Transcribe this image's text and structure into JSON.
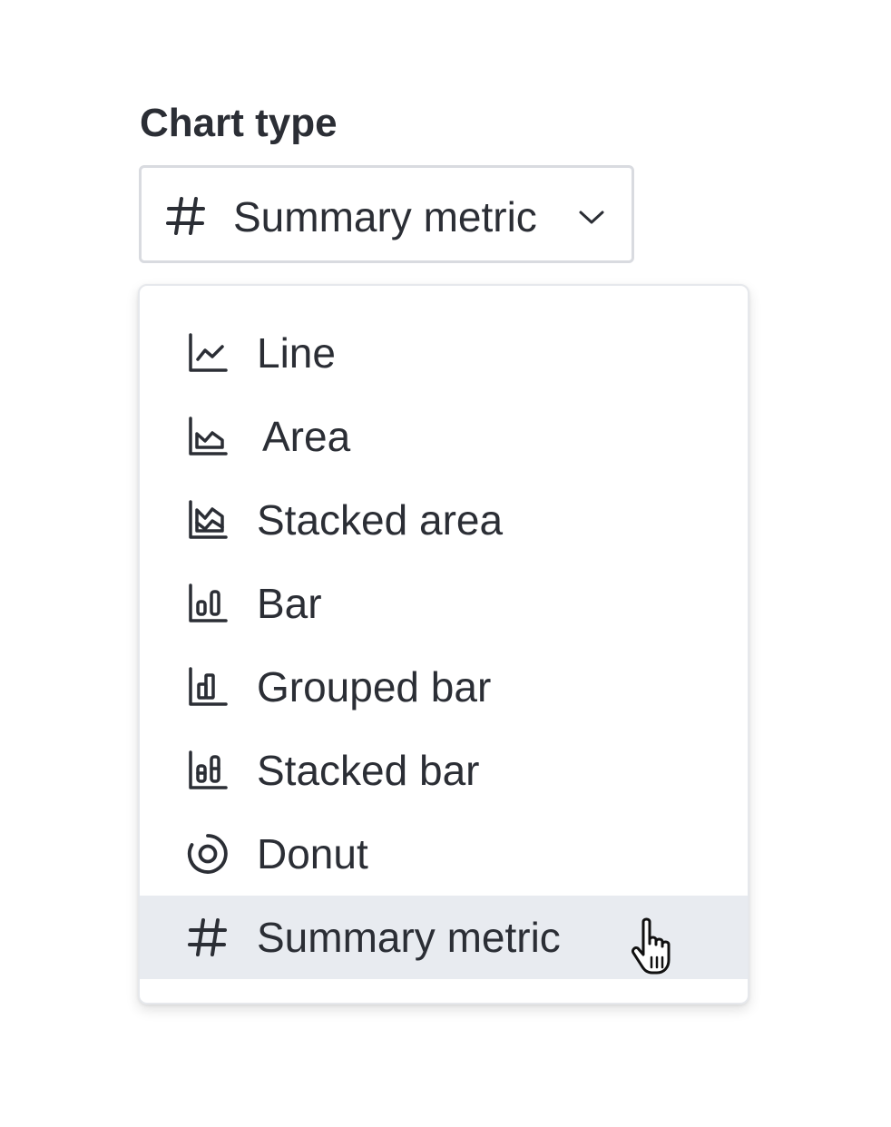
{
  "field": {
    "label": "Chart type",
    "selected_value": "Summary metric",
    "selected_icon": "hash-icon"
  },
  "menu": {
    "items": [
      {
        "label": "Line",
        "icon": "line-chart-icon"
      },
      {
        "label": "Area",
        "icon": "area-chart-icon"
      },
      {
        "label": "Stacked area",
        "icon": "stacked-area-chart-icon"
      },
      {
        "label": "Bar",
        "icon": "bar-chart-icon"
      },
      {
        "label": "Grouped bar",
        "icon": "grouped-bar-chart-icon"
      },
      {
        "label": "Stacked bar",
        "icon": "stacked-bar-chart-icon"
      },
      {
        "label": "Donut",
        "icon": "donut-chart-icon"
      },
      {
        "label": "Summary metric",
        "icon": "hash-icon",
        "selected": true
      }
    ]
  },
  "colors": {
    "text": "#2b2e35",
    "border": "#d9dbe0",
    "selected_bg": "#e8ebf0"
  }
}
